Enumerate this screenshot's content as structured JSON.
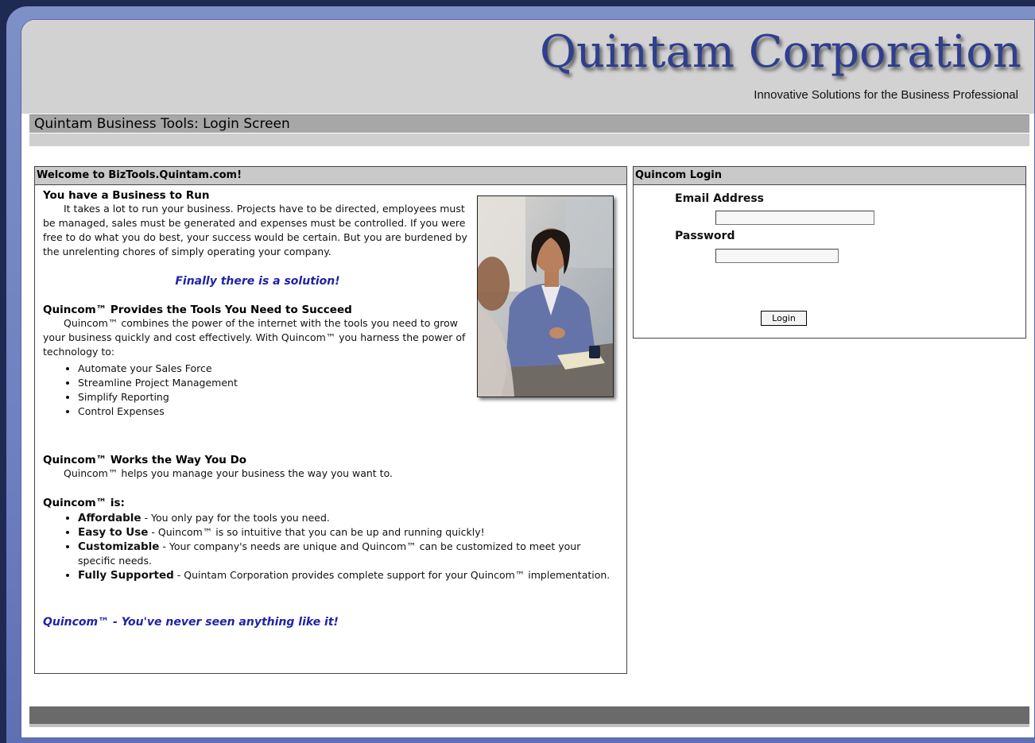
{
  "header": {
    "company": "Quintam Corporation",
    "tagline": "Innovative Solutions for the Business Professional"
  },
  "title_bar": "Quintam Business Tools: Login Screen",
  "welcome": {
    "heading": "Welcome to BizTools.Quintam.com!",
    "section1_title": "You have a Business to Run",
    "section1_body": "It takes a lot to run your business.  Projects have to be directed, employees must be managed, sales must be generated and expenses must be controlled.  If you were free to do what you do best, your success would be certain.  But you are burdened by the unrelenting chores of simply operating your company.",
    "solution": "Finally there is a solution!",
    "section2_title": "Quincom™ Provides the Tools You Need to Succeed",
    "section2_body": "Quincom™ combines the power of the internet with the tools you need to grow your business quickly and cost effectively.  With Quincom™ you harness the power of technology to:",
    "tools": [
      "Automate your Sales Force",
      "Streamline Project Management",
      "Simplify Reporting",
      "Control Expenses"
    ],
    "section3_title": "Quincom™ Works the Way You Do",
    "section3_body": "Quincom™ helps you manage your business the way you want to.",
    "section4_title": "Quincom™ is:",
    "features": [
      {
        "term": "Affordable",
        "desc": " - You only pay for the tools you need."
      },
      {
        "term": "Easy to Use",
        "desc": " - Quincom™ is so intuitive that you can be up and running quickly!"
      },
      {
        "term": "Customizable",
        "desc": " - Your company's needs are unique and Quincom™ can be customized to meet your specific needs."
      },
      {
        "term": "Fully Supported",
        "desc": " - Quintam Corporation provides complete support for your Quincom™ implementation."
      }
    ],
    "closing": "Quincom™ - You've never seen anything like it!"
  },
  "login": {
    "heading": "Quincom Login",
    "email_label": "Email Address",
    "email_value": "",
    "password_label": "Password",
    "password_value": "",
    "button_label": "Login"
  },
  "colors": {
    "frame": "#6f7fc0",
    "logo": "#2f3f8e",
    "accent_blue": "#1f23a8",
    "header_bg": "#d2d2d2",
    "footer_bar": "#6a6a6a"
  }
}
